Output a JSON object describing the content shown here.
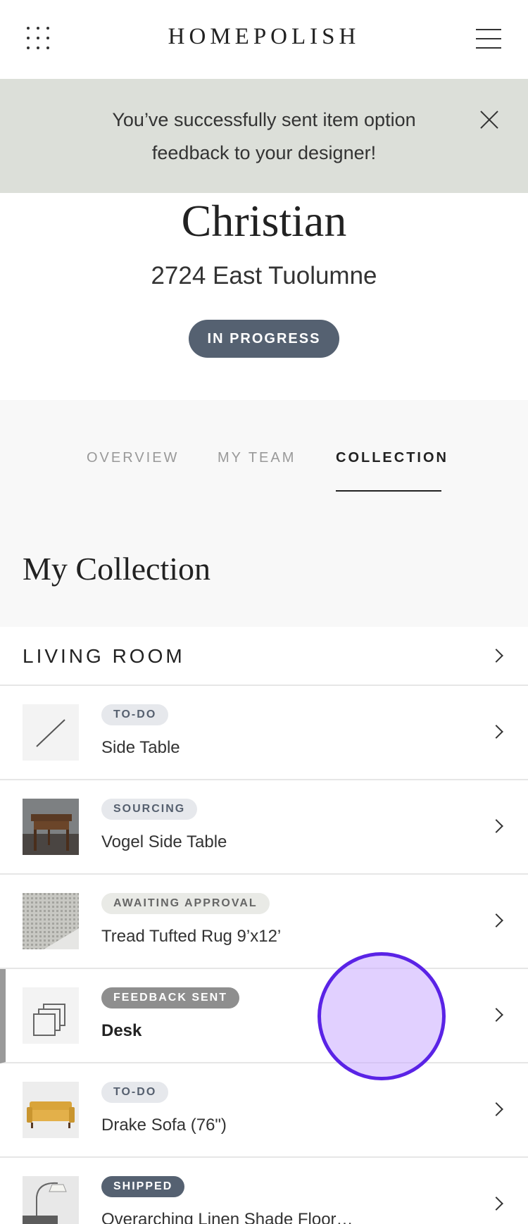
{
  "header": {
    "brand": "HOMEPOLISH",
    "grid_icon": "apps-grid-icon",
    "menu_icon": "hamburger-menu-icon"
  },
  "banner": {
    "message": "You’ve successfully sent item option feedback to your designer!",
    "close_icon": "close-icon"
  },
  "project": {
    "client_name": "Christian",
    "address": "2724 East Tuolumne",
    "status": "IN PROGRESS"
  },
  "tabs": [
    {
      "label": "OVERVIEW",
      "active": false
    },
    {
      "label": "MY TEAM",
      "active": false
    },
    {
      "label": "COLLECTION",
      "active": true
    }
  ],
  "collection": {
    "title": "My Collection",
    "room": "LIVING ROOM",
    "items": [
      {
        "badge": "TO-DO",
        "name": "Side Table",
        "thumbnail": "placeholder-slash"
      },
      {
        "badge": "SOURCING",
        "name": "Vogel Side Table",
        "thumbnail": "wooden-side-table-photo"
      },
      {
        "badge": "AWAITING APPROVAL",
        "name": "Tread Tufted Rug 9’x12’",
        "thumbnail": "gray-rug-photo"
      },
      {
        "badge": "FEEDBACK SENT",
        "name": "Desk",
        "thumbnail": "item-options-icon"
      },
      {
        "badge": "TO-DO",
        "name": "Drake Sofa (76\")",
        "thumbnail": "yellow-sofa-photo"
      },
      {
        "badge": "SHIPPED",
        "name": "Overarching Linen Shade Floor…",
        "thumbnail": "arc-floor-lamp-photo"
      }
    ]
  },
  "colors": {
    "status_pill": "#556171",
    "banner_bg": "#dcdfd9",
    "touch_indicator": "#5a23e6"
  }
}
